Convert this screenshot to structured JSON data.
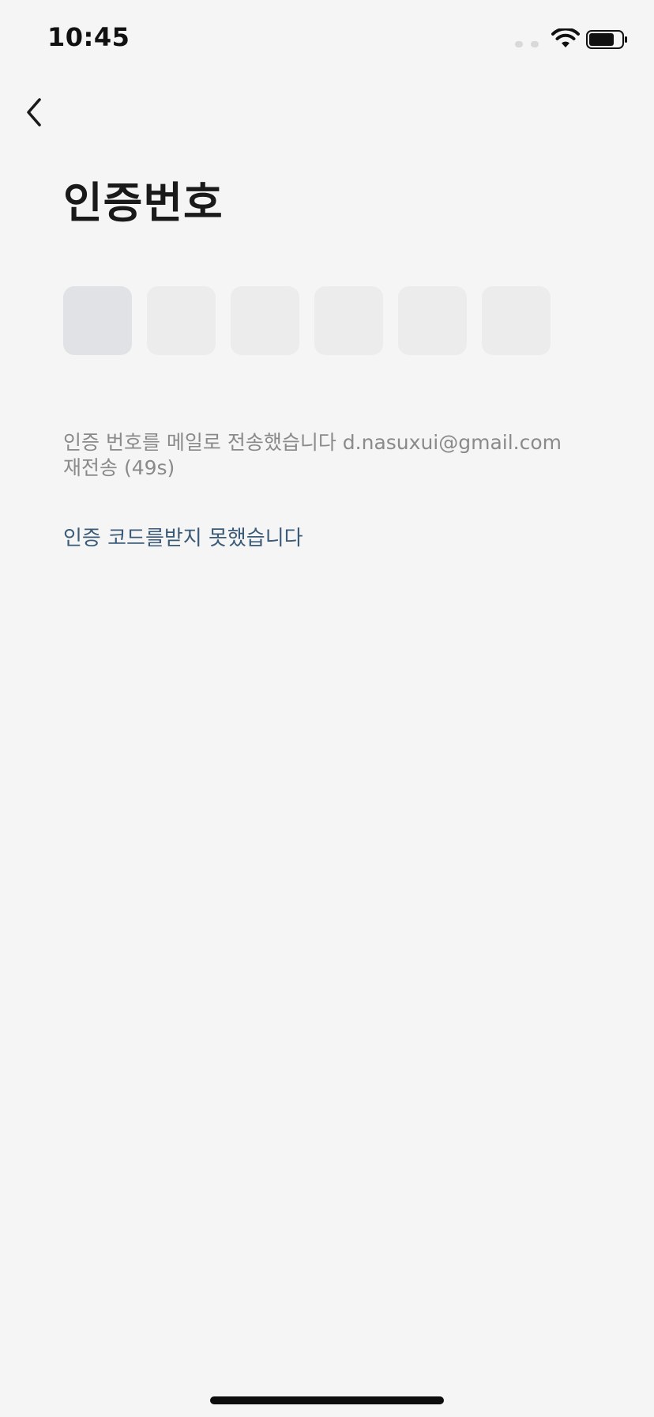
{
  "status_bar": {
    "time": "10:45",
    "wifi_icon": "wifi-icon",
    "battery_icon": "battery-icon"
  },
  "header": {
    "back_icon": "chevron-left-icon"
  },
  "main": {
    "title": "인증번호",
    "code_length": 6,
    "code_values": [
      "",
      "",
      "",
      "",
      "",
      ""
    ],
    "info_prefix": "인증 번호를 메일로 전송했습니다",
    "email": "d.nasuxui@gmail.com",
    "resend_label": "재전송 (49s)",
    "no_code_link": "인증 코드를받지 못했습니다"
  },
  "colors": {
    "background": "#f5f5f5",
    "box_active": "#e1e2e5",
    "box_idle": "#ececec",
    "link": "#3a5a78",
    "muted_text": "#8a8a8a"
  }
}
